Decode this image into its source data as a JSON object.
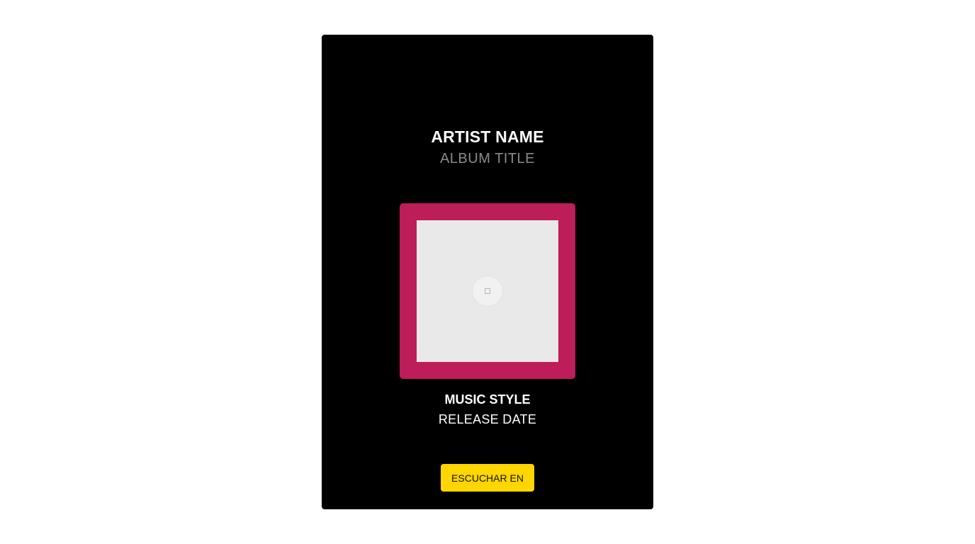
{
  "card": {
    "artist_name": "ARTIST NAME",
    "album_title": "ALBUM TITLE",
    "music_style": "MUSIC STYLE",
    "release_date": "RELEASE DATE",
    "listen_button_label": "ESCUCHAR EN",
    "cover_icon": "image-placeholder-icon"
  },
  "colors": {
    "card_background": "#000000",
    "cover_frame": "#bd1d58",
    "cover_placeholder": "#e9e9e9",
    "button": "#ffd600",
    "album_text": "#8a8a8a"
  }
}
